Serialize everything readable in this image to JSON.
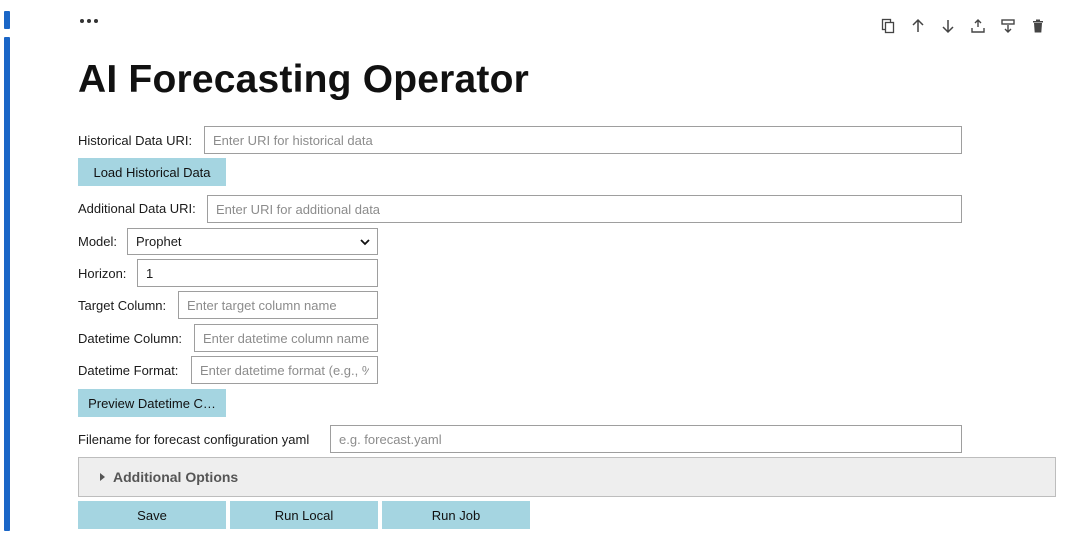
{
  "title": "AI Forecasting Operator",
  "toolbar": {
    "icons": [
      "duplicate-icon",
      "move-up-icon",
      "move-down-icon",
      "insert-above-icon",
      "insert-below-icon",
      "delete-icon"
    ]
  },
  "historical": {
    "label": "Historical Data URI:",
    "placeholder": "Enter URI for historical data",
    "value": "",
    "load_button": "Load Historical Data"
  },
  "additional": {
    "label": "Additional Data URI:",
    "placeholder": "Enter URI for additional data",
    "value": ""
  },
  "model": {
    "label": "Model:",
    "selected": "Prophet"
  },
  "horizon": {
    "label": "Horizon:",
    "value": "1"
  },
  "target_column": {
    "label": "Target Column:",
    "placeholder": "Enter target column name"
  },
  "datetime_column": {
    "label": "Datetime Column:",
    "placeholder": "Enter datetime column name"
  },
  "datetime_format": {
    "label": "Datetime Format:",
    "placeholder": "Enter datetime format (e.g., %",
    "preview_button": "Preview Datetime C…"
  },
  "filename": {
    "label": "Filename for forecast configuration yaml",
    "placeholder": "e.g. forecast.yaml"
  },
  "additional_options": {
    "label": "Additional Options"
  },
  "actions": {
    "save": "Save",
    "run_local": "Run Local",
    "run_job": "Run Job"
  },
  "colors": {
    "cell_bar": "#1a66c7",
    "button_bg": "#a5d5e1",
    "accordion_bg": "#eeeeee"
  }
}
